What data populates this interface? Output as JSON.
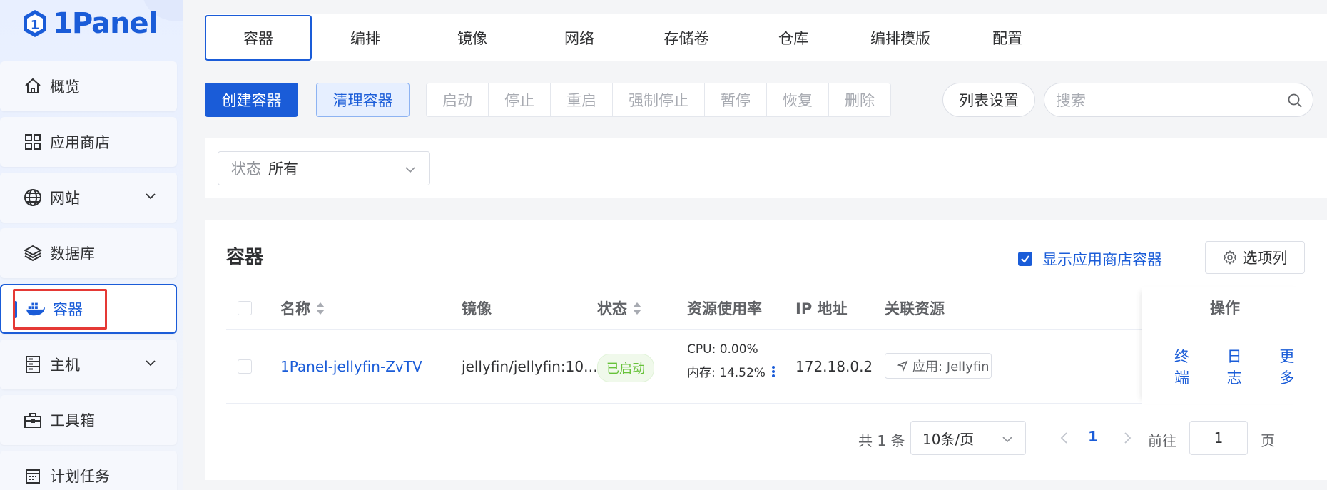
{
  "app": {
    "logo_text": "1Panel"
  },
  "sidebar": {
    "items": [
      {
        "label": "概览",
        "icon": "home-icon"
      },
      {
        "label": "应用商店",
        "icon": "grid-icon"
      },
      {
        "label": "网站",
        "icon": "globe-icon",
        "expandable": true
      },
      {
        "label": "数据库",
        "icon": "layers-icon"
      },
      {
        "label": "容器",
        "icon": "docker-icon",
        "active": true
      },
      {
        "label": "主机",
        "icon": "server-icon",
        "expandable": true
      },
      {
        "label": "工具箱",
        "icon": "toolbox-icon"
      },
      {
        "label": "计划任务",
        "icon": "calendar-icon"
      }
    ]
  },
  "tabs": [
    "容器",
    "编排",
    "镜像",
    "网络",
    "存储卷",
    "仓库",
    "编排模版",
    "配置"
  ],
  "toolbar": {
    "create": "创建容器",
    "clean": "清理容器",
    "actions": [
      "启动",
      "停止",
      "重启",
      "强制停止",
      "暂停",
      "恢复",
      "删除"
    ],
    "list_settings": "列表设置",
    "search_placeholder": "搜索"
  },
  "filter": {
    "label": "状态",
    "value": "所有"
  },
  "card": {
    "title": "容器",
    "show_app_containers": "显示应用商店容器",
    "options": "选项列"
  },
  "table": {
    "columns": {
      "name": "名称",
      "image": "镜像",
      "status": "状态",
      "resource": "资源使用率",
      "ip": "IP 地址",
      "related": "关联资源",
      "ops": "操作"
    },
    "rows": [
      {
        "name": "1Panel-jellyfin-ZvTV",
        "image": "jellyfin/jellyfin:10.…",
        "status": "已启动",
        "cpu": "CPU: 0.00%",
        "mem": "内存: 14.52%",
        "ip": "172.18.0.2",
        "related": "应用: Jellyfin",
        "ops": [
          "终端",
          "日志",
          "更多"
        ]
      }
    ]
  },
  "pagination": {
    "total": "共 1 条",
    "page_size": "10条/页",
    "current": "1",
    "goto_label": "前往",
    "goto_value": "1",
    "page_suffix": "页"
  },
  "colors": {
    "primary": "#1a5cd8",
    "success": "#67c23a",
    "highlight": "#e53935"
  }
}
